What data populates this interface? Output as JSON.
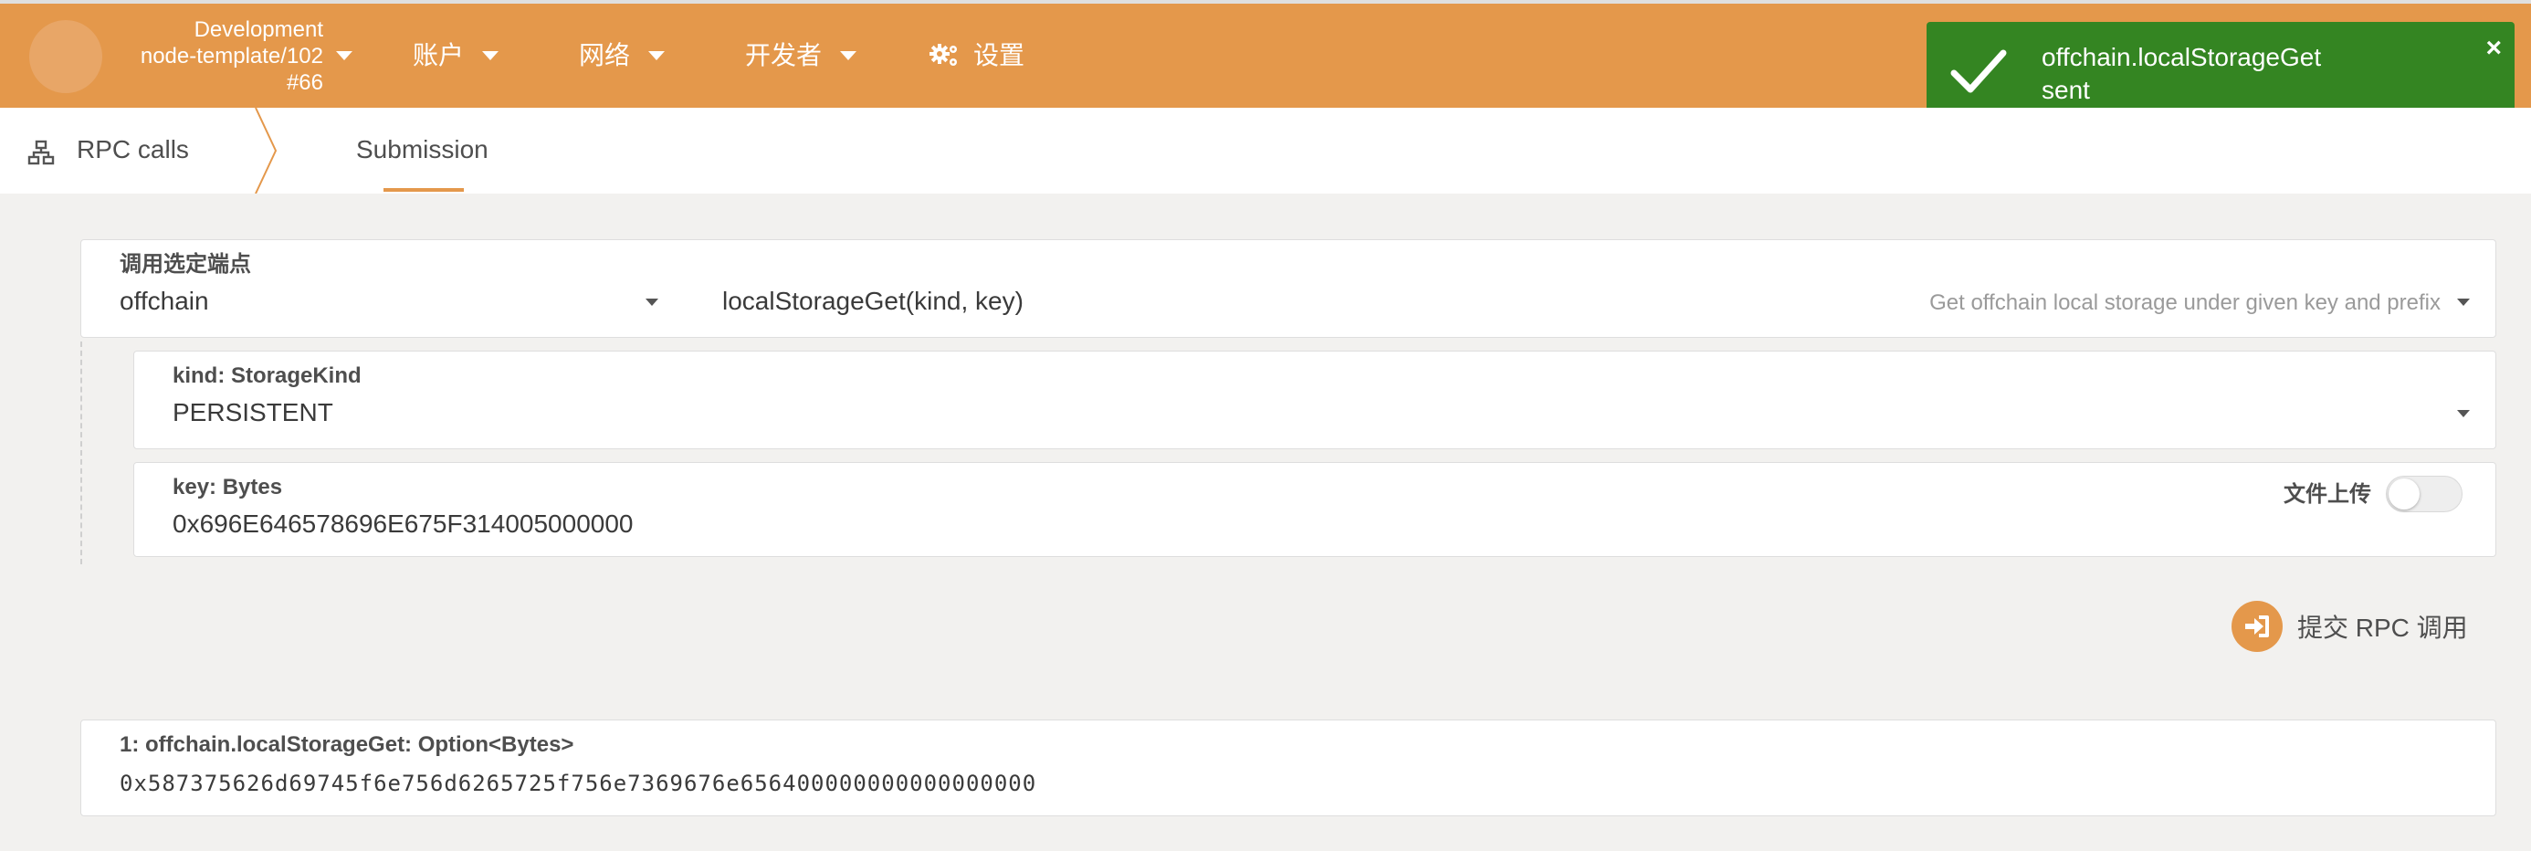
{
  "header": {
    "chain": {
      "line1": "Development",
      "line2": "node-template/102",
      "line3": "#66"
    },
    "nav": [
      {
        "label": "账户"
      },
      {
        "label": "网络"
      },
      {
        "label": "开发者"
      },
      {
        "label": "设置"
      }
    ],
    "brand_color": "#e4984b"
  },
  "toast": {
    "title": "offchain.localStorageGet",
    "status": "sent",
    "close": "×",
    "color": "#348522"
  },
  "subnav": {
    "title": "RPC calls",
    "tab": "Submission"
  },
  "endpoint": {
    "label": "调用选定端点",
    "section": "offchain",
    "method": "localStorageGet(kind, key)",
    "description": "Get offchain local storage under given key and prefix"
  },
  "params": {
    "kind": {
      "label": "kind: StorageKind",
      "value": "PERSISTENT"
    },
    "key": {
      "label": "key: Bytes",
      "value": "0x696E646578696E675F314005000000",
      "file_upload_label": "文件上传",
      "file_upload_on": false
    }
  },
  "submit": {
    "label": "提交 RPC 调用"
  },
  "result": {
    "label": "1: offchain.localStorageGet: Option<Bytes>",
    "value": "0x587375626d69745f6e756d6265725f756e7369676e656400000000000000000"
  }
}
